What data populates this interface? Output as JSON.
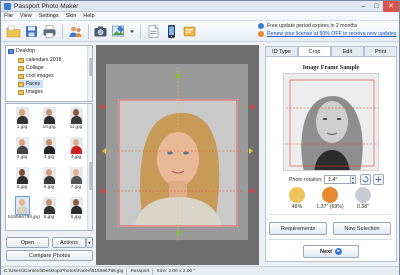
{
  "window": {
    "title": "Passport Photo Maker"
  },
  "menu": [
    "File",
    "View",
    "Settings",
    "Skin",
    "Help"
  ],
  "promo": {
    "expiry": "Free update period expires in 2 months",
    "renew": "Renew your license at 50% OFF to receive new updates"
  },
  "tree": {
    "items": [
      "Desktop",
      "calendars 2018",
      "Collage",
      "cool images",
      "Faces",
      "Images"
    ]
  },
  "thumbnails": [
    {
      "name": "1.jpg"
    },
    {
      "name": "10.jpg"
    },
    {
      "name": "11.jpg"
    },
    {
      "name": "2.jpg"
    },
    {
      "name": "3.jpg"
    },
    {
      "name": "4.jpg"
    },
    {
      "name": "5.jpg"
    },
    {
      "name": "6.jpg"
    },
    {
      "name": "7.jpg"
    },
    {
      "name": "515596786.jpg"
    },
    {
      "name": "8.jpg"
    },
    {
      "name": "9.jpg"
    }
  ],
  "left_buttons": {
    "open": "Open",
    "actions": "Actions",
    "compare": "Compare Photos"
  },
  "tabs": [
    "ID Type",
    "Crop",
    "Edit",
    "Print"
  ],
  "active_tab": "Crop",
  "right": {
    "sample_title": "Image Frame Sample",
    "rotation_label": "Photo rotation:",
    "rotation_value": "1.4°",
    "metrics": [
      "48%",
      "1.37\" (69%)",
      "0.38\""
    ],
    "requirements": "Requirements",
    "new_selection": "New Selection",
    "next": "Next"
  },
  "status": {
    "path": "C:\\Users\\Content\\Desktop\\Photos\\Faces\\515596786.jpg",
    "type": "Passport",
    "size": "Size: 2.00 x 2.00 \""
  },
  "colors": {
    "accent": "#3a7bd5",
    "frame": "#e23c3c",
    "guide_arrow": "#7ec23b",
    "workspace": "#6f6f6f"
  }
}
